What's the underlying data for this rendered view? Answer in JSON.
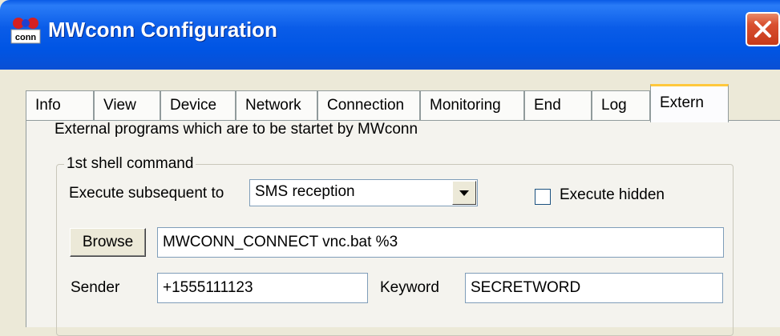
{
  "window": {
    "title": "MWconn Configuration",
    "icon": "mwconn-app-icon"
  },
  "tabs": [
    {
      "label": "Info",
      "active": false
    },
    {
      "label": "View",
      "active": false
    },
    {
      "label": "Device",
      "active": false
    },
    {
      "label": "Network",
      "active": false
    },
    {
      "label": "Connection",
      "active": false
    },
    {
      "label": "Monitoring",
      "active": false
    },
    {
      "label": "End",
      "active": false
    },
    {
      "label": "Log",
      "active": false
    },
    {
      "label": "Extern",
      "active": true
    }
  ],
  "panel": {
    "description": "External programs which are to be startet by MWconn",
    "group_title": "1st shell command",
    "execute_label": "Execute subsequent to",
    "execute_value": "SMS reception",
    "hidden_label": "Execute hidden",
    "hidden_checked": false,
    "browse_label": "Browse",
    "command_value": "MWCONN_CONNECT vnc.bat %3",
    "sender_label": "Sender",
    "sender_value": "+1555111123",
    "keyword_label": "Keyword",
    "keyword_value": "SECRETWORD"
  },
  "colors": {
    "titlebar": "#0a5ce8",
    "close": "#c63a1a",
    "active_tab_accent": "#ffc83c"
  }
}
